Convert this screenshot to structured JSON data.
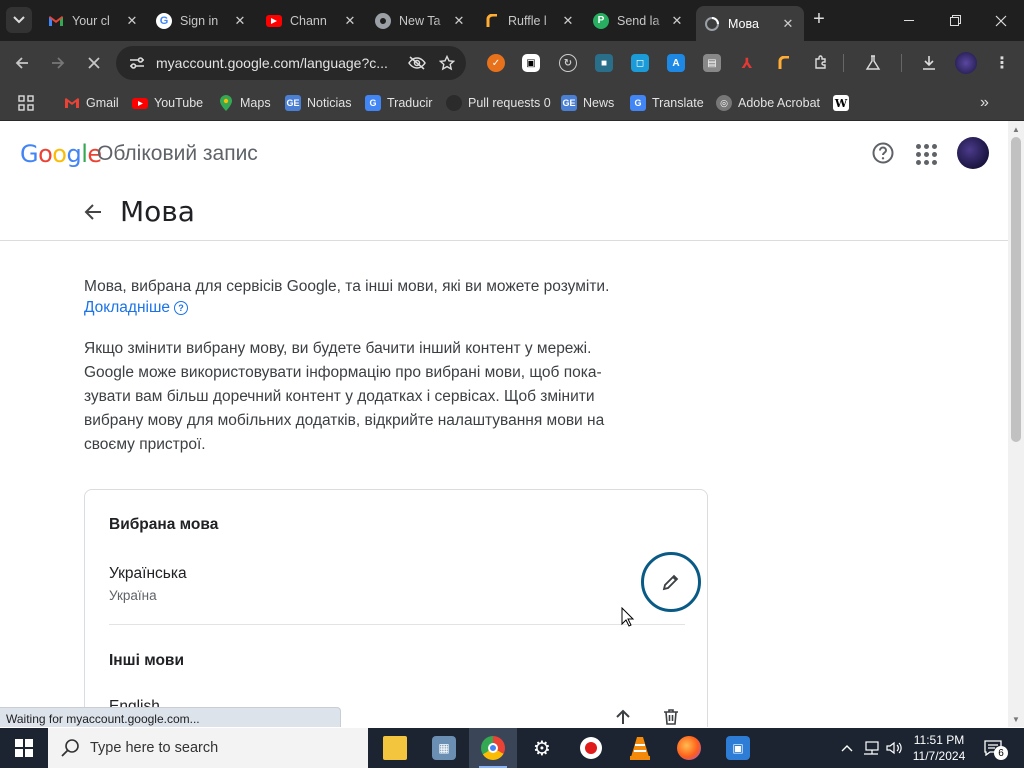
{
  "browser": {
    "tabs": [
      {
        "title": "Your cl",
        "favicon": "gmail-icon",
        "color": "#ea4335"
      },
      {
        "title": "Sign in",
        "favicon": "google-icon",
        "color": "#4285f4"
      },
      {
        "title": "Chann",
        "favicon": "youtube-icon",
        "color": "#ff0000"
      },
      {
        "title": "New Ta",
        "favicon": "chrome-icon",
        "color": "#9aa0a6"
      },
      {
        "title": "Ruffle l",
        "favicon": "ruffle-icon",
        "color": "#ffad33"
      },
      {
        "title": "Send la",
        "favicon": "pushbullet-icon",
        "color": "#27ae60"
      },
      {
        "title": "Мова",
        "favicon": "google-account-icon",
        "color": "#9aa0a6"
      }
    ],
    "address": {
      "url": "myaccount.google.com/language?c..."
    },
    "bookmarks": [
      {
        "label": "Gmail",
        "icon": "gmail-icon"
      },
      {
        "label": "YouTube",
        "icon": "youtube-icon"
      },
      {
        "label": "Maps",
        "icon": "maps-icon"
      },
      {
        "label": "Noticias",
        "icon": "news-icon"
      },
      {
        "label": "Traducir",
        "icon": "translate-icon"
      },
      {
        "label": "Pull requests 0",
        "icon": "github-icon"
      },
      {
        "label": "News",
        "icon": "news-icon"
      },
      {
        "label": "Translate",
        "icon": "translate-icon"
      },
      {
        "label": "Adobe Acrobat",
        "icon": "acrobat-icon"
      },
      {
        "label": "W",
        "icon": "wikipedia-icon"
      }
    ],
    "status_text": "Waiting for myaccount.google.com..."
  },
  "header": {
    "logo": "Google",
    "product": "Обліковий запис"
  },
  "page": {
    "title": "Мова",
    "intro": "Мова, вибрана для сервісів Google, та інші мови, які ви можете розуміти.",
    "learn_more": "Докладніше",
    "paragraph": "Якщо змінити вибрану мову, ви будете бачити інший контент у мережі. Google може використовувати інформацію про вибрані мови, щоб пока-зувати вам більш доречний контент у додатках і сервісах. Щоб змінити вибрану мову для мобільних додатків, відкрийте налаштування мови на своєму пристрої."
  },
  "card": {
    "preferred_title": "Вибрана мова",
    "preferred_language": "Українська",
    "preferred_region": "Україна",
    "other_title": "Інші мови",
    "other_language": "English"
  },
  "taskbar": {
    "search_placeholder": "Type here to search",
    "time": "11:51 PM",
    "date": "11/7/2024",
    "notifications": "6"
  },
  "colors": {
    "accent_link": "#1a73e8",
    "edit_ring": "#0a5a86"
  }
}
